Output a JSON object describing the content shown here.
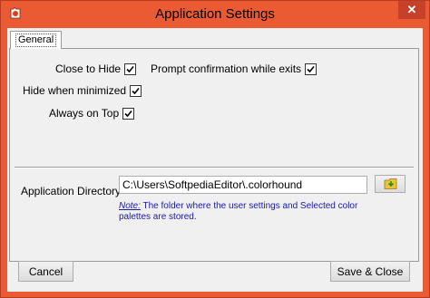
{
  "window": {
    "title": "Application Settings",
    "close_glyph": "✕",
    "app_icon": "app-logo-icon",
    "accent_color": "#eb5b33"
  },
  "tabs": [
    {
      "label": "General",
      "active": true
    }
  ],
  "options": {
    "close_to_hide": {
      "label": "Close to Hide",
      "checked": true
    },
    "hide_when_minimized": {
      "label": "Hide when minimized",
      "checked": true
    },
    "always_on_top": {
      "label": "Always on Top",
      "checked": true
    },
    "prompt_confirmation": {
      "label": "Prompt confirmation while exits",
      "checked": true
    }
  },
  "directory": {
    "label": "Application Directory",
    "value": "C:\\Users\\SoftpediaEditor\\.colorhound",
    "browse_icon": "folder-browse-icon",
    "note_label": "Note:",
    "note_text": " The folder where the user settings and Selected color palettes are stored."
  },
  "buttons": {
    "cancel": "Cancel",
    "save_close": "Save & Close"
  }
}
